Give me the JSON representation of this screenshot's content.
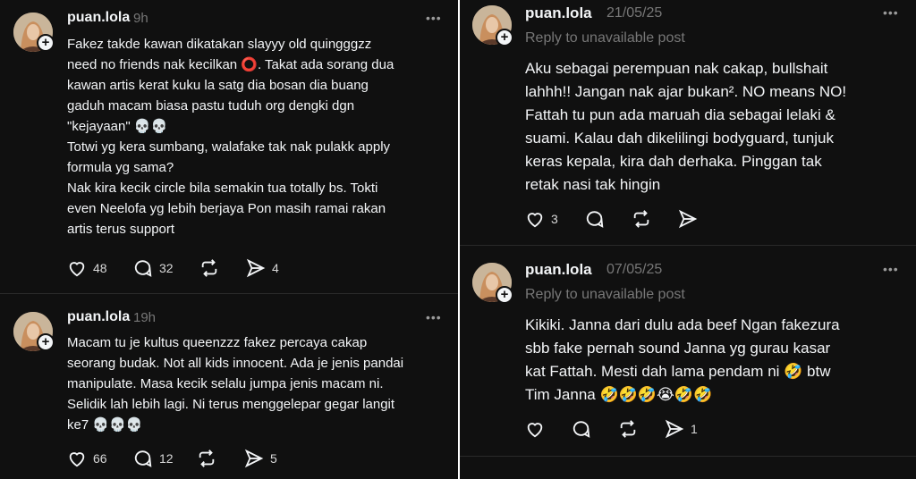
{
  "left_posts": [
    {
      "username": "puan.lola",
      "time": "9h",
      "text": "Fakez takde kawan dikatakan slayyy old quingggzz\nneed no friends nak kecilkan ⭕. Takat ada sorang dua\nkawan artis kerat kuku la satg dia bosan dia buang\ngaduh macam biasa pastu tuduh org dengki dgn\n\"kejayaan\" 💀💀\nTotwi yg kera sumbang, walafake  tak nak pulakk apply\nformula yg sama?\nNak kira kecik circle bila semakin tua totally bs. Tokti\neven Neelofa  yg lebih berjaya Pon masih ramai rakan\nartis terus support",
      "likes": "48",
      "replies": "32",
      "reposts": "",
      "shares": "4"
    },
    {
      "username": "puan.lola",
      "time": "19h",
      "text": "Macam tu je kultus queenzzz fakez percaya cakap\nseorang budak. Not all kids innocent. Ada je jenis pandai\nmanipulate. Masa kecik selalu jumpa jenis macam ni.\nSelidik lah lebih lagi. Ni terus menggelepar gegar langit\nke7 💀💀💀",
      "likes": "66",
      "replies": "12",
      "reposts": "",
      "shares": "5"
    }
  ],
  "right_posts": [
    {
      "username": "puan.lola",
      "time": "21/05/25",
      "reply_context": "Reply to unavailable post",
      "text": "Aku sebagai perempuan nak cakap, bullshait\nlahhh!! Jangan nak ajar bukan². NO means NO!\nFattah tu pun ada maruah dia sebagai lelaki &\nsuami. Kalau dah dikelilingi bodyguard, tunjuk\nkeras kepala, kira dah derhaka. Pinggan tak\nretak nasi tak hingin",
      "likes": "3",
      "replies": "",
      "reposts": "",
      "shares": ""
    },
    {
      "username": "puan.lola",
      "time": "07/05/25",
      "reply_context": "Reply to unavailable post",
      "text": "Kikiki. Janna dari dulu ada beef Ngan fakezura\nsbb fake pernah sound Janna yg gurau kasar\nkat Fattah. Mesti dah lama pendam ni 🤣 btw\nTim Janna 🤣🤣🤣😭🤣🤣",
      "likes": "",
      "replies": "",
      "reposts": "",
      "shares": "1"
    }
  ],
  "more_symbol": "•••",
  "plus_symbol": "+",
  "icons": [
    "heart-icon",
    "comment-icon",
    "repost-icon",
    "share-icon",
    "more-icon",
    "avatar",
    "follow-plus-icon"
  ],
  "colors": {
    "background": "#101010",
    "text": "#f3f5f7",
    "muted": "#777777",
    "divider": "#2a2a2a"
  }
}
